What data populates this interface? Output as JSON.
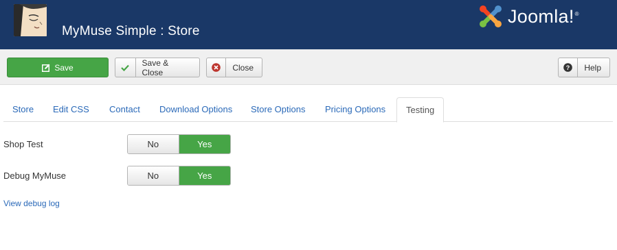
{
  "header": {
    "title": "MyMuse Simple : Store",
    "brand": "Joomla!",
    "brand_color": "#1a3867"
  },
  "toolbar": {
    "save_label": "Save",
    "save_close_label": "Save & Close",
    "close_label": "Close",
    "help_label": "Help",
    "save_color": "#46a546"
  },
  "tabs": [
    {
      "label": "Store",
      "active": false
    },
    {
      "label": "Edit CSS",
      "active": false
    },
    {
      "label": "Contact",
      "active": false
    },
    {
      "label": "Download Options",
      "active": false
    },
    {
      "label": "Store Options",
      "active": false
    },
    {
      "label": "Pricing Options",
      "active": false
    },
    {
      "label": "Testing",
      "active": true
    }
  ],
  "form": {
    "shop_test": {
      "label": "Shop Test",
      "no": "No",
      "yes": "Yes",
      "value": "Yes"
    },
    "debug_mymuse": {
      "label": "Debug MyMuse",
      "no": "No",
      "yes": "Yes",
      "value": "Yes"
    },
    "debug_log_link": "View debug log"
  },
  "icons": {
    "save": "edit-icon",
    "save_close": "check-icon",
    "close": "cancel-circle-icon",
    "help": "question-circle-icon"
  }
}
